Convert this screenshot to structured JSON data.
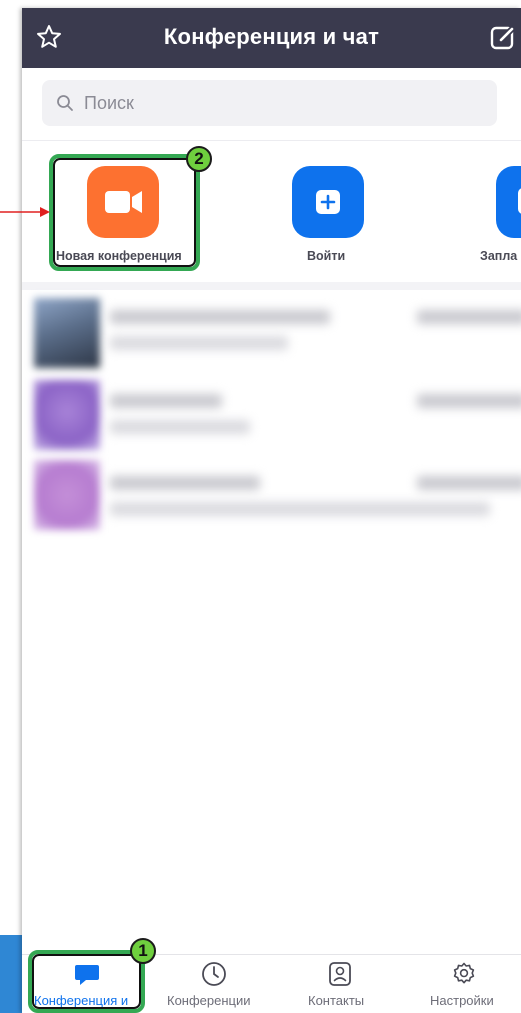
{
  "header": {
    "title": "Конференция и чат",
    "star_icon": "star-icon",
    "compose_icon": "compose-icon"
  },
  "search": {
    "placeholder": "Поиск"
  },
  "actions": [
    {
      "label": "Новая конференция",
      "icon": "video-camera-icon",
      "color": "#fd7130"
    },
    {
      "label": "Войти",
      "icon": "plus-icon",
      "color": "#0e72ed"
    },
    {
      "label": "Запла",
      "icon": "calendar-icon",
      "color": "#0e72ed"
    }
  ],
  "annotations": {
    "badge_1": "1",
    "badge_2": "2",
    "highlight_color": "#34a853",
    "arrow_color": "#e02020"
  },
  "tabs": [
    {
      "label": "Конференция и",
      "icon": "chat-bubble-icon",
      "active": true
    },
    {
      "label": "Конференции",
      "icon": "clock-icon",
      "active": false
    },
    {
      "label": "Контакты",
      "icon": "contact-card-icon",
      "active": false
    },
    {
      "label": "Настройки",
      "icon": "gear-icon",
      "active": false
    }
  ],
  "colors": {
    "header_bg": "#3a3a4e",
    "accent_blue": "#0e72ed",
    "accent_orange": "#fd7130"
  }
}
